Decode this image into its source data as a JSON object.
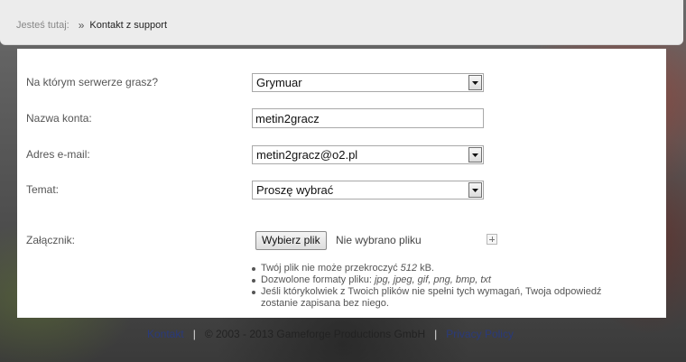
{
  "breadcrumb": {
    "label": "Jesteś tutaj:",
    "separator": "»",
    "current": "Kontakt z support"
  },
  "form": {
    "server": {
      "label": "Na którym serwerze grasz?",
      "value": "Grymuar"
    },
    "account": {
      "label": "Nazwa konta:",
      "value": "metin2gracz"
    },
    "email": {
      "label": "Adres e-mail:",
      "value": "metin2gracz@o2.pl"
    },
    "subject": {
      "label": "Temat:",
      "value": "Proszę wybrać"
    },
    "attachment": {
      "label": "Załącznik:",
      "button": "Wybierz plik",
      "status": "Nie wybrano pliku"
    },
    "notes": {
      "size_prefix": "Twój plik nie może przekroczyć ",
      "size_value": "512",
      "size_suffix": " kB.",
      "formats_prefix": "Dozwolone formaty pliku: ",
      "formats_value": "jpg, jpeg, gif, png, bmp, txt",
      "warning": "Jeśli którykolwiek z Twoich plików nie spełni tych wymagań, Twoja odpowiedź zostanie zapisana bez niego."
    }
  },
  "footer": {
    "contact": "Kontakt",
    "separator": "|",
    "copyright": "© 2003 - 2013 Gameforge Productions GmbH",
    "privacy": "Privacy Policy"
  },
  "icons": {
    "select_arrow": "chevron-down-icon",
    "add": "plus-icon"
  }
}
